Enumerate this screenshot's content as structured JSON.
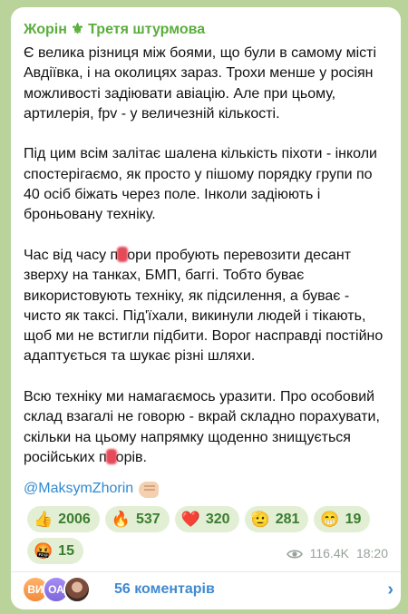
{
  "post": {
    "channel_name": "Жорін ⚜ Третя штурмова",
    "paragraphs": [
      "Є велика різниця між боями, що були в самому місті Авдіївка, і на околицях зараз. Трохи менше у росіян можливості задіювати авіацію. Але при цьому, артилерія, fpv - у величезній кількості.",
      "Під цим всім залітає шалена кількість піхоти - інколи спостерігаємо, як просто у пішому порядку групи по 40 осіб біжать через поле. Інколи задіюють і броньовану техніку."
    ],
    "para3": {
      "before": "Час від часу п",
      "after": "ори пробують перевозити десант зверху на танках, БМП, баггі. Тобто буває використовують техніку, як підсилення, а буває - чисто як таксі. Під'їхали, викинули людей і тікають, щоб ми не встигли підбити. Ворог насправді постійно адаптується та шукає різні шляхи."
    },
    "para4": {
      "before": "Всю техніку ми намагаємось уразити. Про особовий склад взагалі не говорю - вкрай складно порахувати, скільки на цьому напрямку щоденно знищується російських п",
      "after": "орів."
    },
    "mention": "@MaksymZhorin",
    "reactions": [
      {
        "icon": "👍",
        "icon_name": "thumbs-up-icon",
        "count": "2006"
      },
      {
        "icon": "🔥",
        "icon_name": "fire-icon",
        "count": "537"
      },
      {
        "icon": "❤️",
        "icon_name": "heart-icon",
        "count": "320"
      },
      {
        "icon": "🫡",
        "icon_name": "salute-icon",
        "count": "281"
      },
      {
        "icon": "😁",
        "icon_name": "grin-icon",
        "count": "19"
      },
      {
        "icon": "🤬",
        "icon_name": "angry-icon",
        "count": "15"
      }
    ],
    "views": "116.4K",
    "time": "18:20"
  },
  "comments": {
    "avatars": [
      "ВИ",
      "ОА",
      ""
    ],
    "label": "56 коментарів"
  },
  "colors": {
    "background": "#b9d39a",
    "channel_name": "#5aae3c",
    "link": "#2f8ad1",
    "reaction_bg": "#e2efd4",
    "comments_link": "#3f89d0"
  }
}
